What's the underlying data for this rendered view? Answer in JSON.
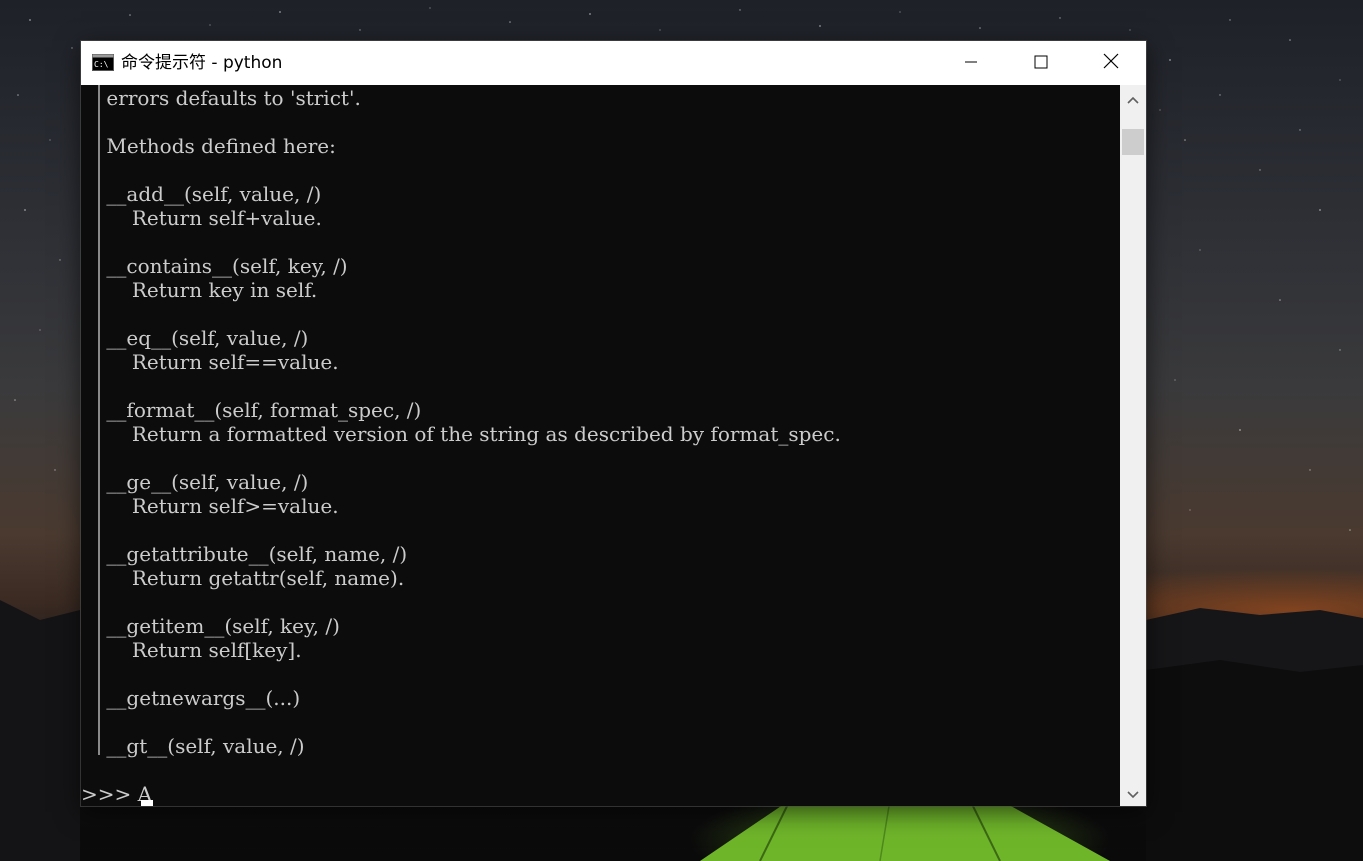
{
  "window": {
    "title": "命令提示符 - python",
    "icon": "cmd-icon",
    "buttons": {
      "minimize": "minimize-icon",
      "maximize": "maximize-icon",
      "close": "close-icon"
    }
  },
  "console": {
    "lines": [
      "    errors defaults to 'strict'.",
      "",
      "    Methods defined here:",
      "",
      "    __add__(self, value, /)",
      "        Return self+value.",
      "",
      "    __contains__(self, key, /)",
      "        Return key in self.",
      "",
      "    __eq__(self, value, /)",
      "        Return self==value.",
      "",
      "    __format__(self, format_spec, /)",
      "        Return a formatted version of the string as described by format_spec.",
      "",
      "    __ge__(self, value, /)",
      "        Return self>=value.",
      "",
      "    __getattribute__(self, name, /)",
      "        Return getattr(self, name).",
      "",
      "    __getitem__(self, key, /)",
      "        Return self[key].",
      "",
      "    __getnewargs__(...)",
      "",
      "    __gt__(self, value, /)",
      "",
      ">>> A"
    ]
  },
  "colors": {
    "console_bg": "#0c0c0c",
    "console_text": "#cccccc",
    "titlebar_bg": "#ffffff",
    "scrollbar_bg": "#f0f0f0",
    "scroll_thumb": "#cdcdcd"
  }
}
